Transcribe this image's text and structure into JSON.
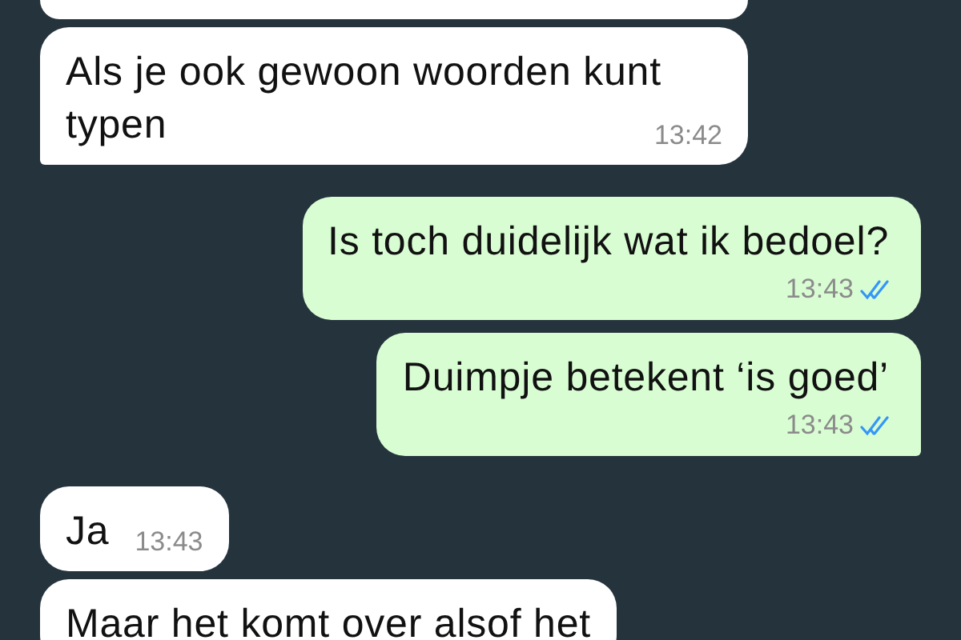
{
  "partial_message_above": {
    "outgoing": false
  },
  "messages": [
    {
      "outgoing": false,
      "kind": "float",
      "text": "Als je ook gewoon woorden kunt typen",
      "time": "13:42",
      "tail": true
    },
    {
      "outgoing": true,
      "kind": "stacked",
      "text": "Is toch duidelijk wat ik bedoel?",
      "time": "13:43",
      "read": true,
      "tail": false
    },
    {
      "outgoing": true,
      "kind": "stacked",
      "text": "Duimpje betekent ‘is goed’",
      "time": "13:43",
      "read": true,
      "tail": true
    },
    {
      "outgoing": false,
      "kind": "float",
      "text": "Ja",
      "time": "13:43",
      "tail": false
    },
    {
      "outgoing": false,
      "kind": "float",
      "text": "Maar het komt over alsof het",
      "tail": false
    }
  ]
}
